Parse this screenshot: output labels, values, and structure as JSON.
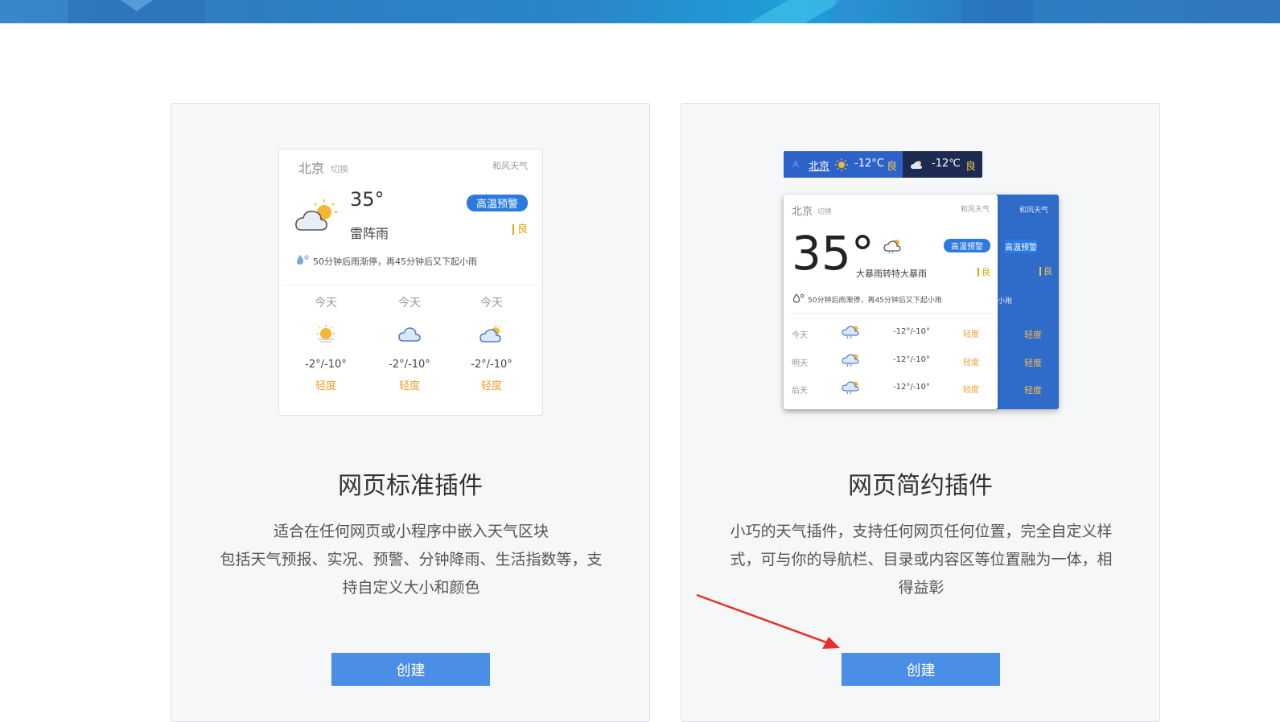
{
  "standard": {
    "widget": {
      "city": "北京",
      "switch_label": "切换",
      "brand": "和风天气",
      "temp": "35°",
      "condition": "雷阵雨",
      "alert": "高温预警",
      "aqi": "良",
      "minute_rain": "50分钟后雨渐停，再45分钟后又下起小雨",
      "forecast": [
        {
          "day": "今天",
          "icon": "sun-haze-icon",
          "range": "-2°/-10°",
          "level": "轻度"
        },
        {
          "day": "今天",
          "icon": "cloud-icon",
          "range": "-2°/-10°",
          "level": "轻度"
        },
        {
          "day": "今天",
          "icon": "partly-cloudy-icon",
          "range": "-2°/-10°",
          "level": "轻度"
        }
      ]
    },
    "title": "网页标准插件",
    "desc": [
      "适合在任何网页或小程序中嵌入天气区块",
      "包括天气预报、实况、预警、分钟降雨、生活指数等，支",
      "持自定义大小和颜色"
    ],
    "button": "创建"
  },
  "simple": {
    "bar": {
      "city": "北京",
      "temp1": "-12°C",
      "aqi1": "良",
      "temp2": "-12℃",
      "aqi2": "良"
    },
    "widget": {
      "city": "北京",
      "switch_label": "切换",
      "brand": "和风天气",
      "temp": "35°",
      "condition": "大暴雨转特大暴雨",
      "alert": "高温预警",
      "aqi": "良",
      "minute_rain": "50分钟后雨渐停，再45分钟后又下起小雨",
      "rows": [
        {
          "day": "今天",
          "range": "-12°/-10°",
          "level": "轻度"
        },
        {
          "day": "明天",
          "range": "-12°/-10°",
          "level": "轻度"
        },
        {
          "day": "后天",
          "range": "-12°/-10°",
          "level": "轻度"
        }
      ]
    },
    "back_panel": {
      "brand": "和风天气",
      "alert": "高温预警",
      "aqi": "良",
      "minute_tail": "小雨",
      "levels": [
        "轻度",
        "轻度",
        "轻度"
      ]
    },
    "title": "网页简约插件",
    "desc": [
      "小巧的天气插件，支持任何网页任何位置，完全自定义样",
      "式，可与你的导航栏、目录或内容区等位置融为一体，相",
      "得益彰"
    ],
    "button": "创建"
  },
  "colors": {
    "accent": "#4a8ee6",
    "alert": "#2a7ae2",
    "level": "#f0a030",
    "annotation_arrow": "#e8302a"
  }
}
